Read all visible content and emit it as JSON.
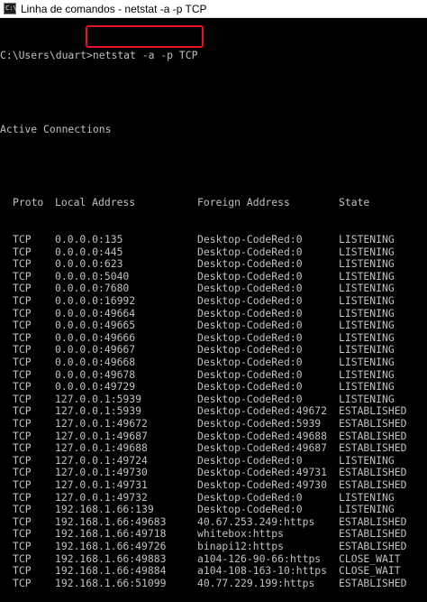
{
  "window": {
    "icon": "terminal-icon",
    "icon_glyph": "C:\\",
    "title": "Linha de comandos - netstat  -a -p TCP"
  },
  "console": {
    "prompt": "C:\\Users\\duart>",
    "command": "netstat -a -p TCP",
    "heading": "Active Connections",
    "highlight_color": "#e81123",
    "columns": {
      "proto": "Proto",
      "local": "Local Address",
      "foreign": "Foreign Address",
      "state": "State"
    },
    "rows": [
      {
        "proto": "TCP",
        "local": "0.0.0.0:135",
        "foreign": "Desktop-CodeRed:0",
        "state": "LISTENING"
      },
      {
        "proto": "TCP",
        "local": "0.0.0.0:445",
        "foreign": "Desktop-CodeRed:0",
        "state": "LISTENING"
      },
      {
        "proto": "TCP",
        "local": "0.0.0.0:623",
        "foreign": "Desktop-CodeRed:0",
        "state": "LISTENING"
      },
      {
        "proto": "TCP",
        "local": "0.0.0.0:5040",
        "foreign": "Desktop-CodeRed:0",
        "state": "LISTENING"
      },
      {
        "proto": "TCP",
        "local": "0.0.0.0:7680",
        "foreign": "Desktop-CodeRed:0",
        "state": "LISTENING"
      },
      {
        "proto": "TCP",
        "local": "0.0.0.0:16992",
        "foreign": "Desktop-CodeRed:0",
        "state": "LISTENING"
      },
      {
        "proto": "TCP",
        "local": "0.0.0.0:49664",
        "foreign": "Desktop-CodeRed:0",
        "state": "LISTENING"
      },
      {
        "proto": "TCP",
        "local": "0.0.0.0:49665",
        "foreign": "Desktop-CodeRed:0",
        "state": "LISTENING"
      },
      {
        "proto": "TCP",
        "local": "0.0.0.0:49666",
        "foreign": "Desktop-CodeRed:0",
        "state": "LISTENING"
      },
      {
        "proto": "TCP",
        "local": "0.0.0.0:49667",
        "foreign": "Desktop-CodeRed:0",
        "state": "LISTENING"
      },
      {
        "proto": "TCP",
        "local": "0.0.0.0:49668",
        "foreign": "Desktop-CodeRed:0",
        "state": "LISTENING"
      },
      {
        "proto": "TCP",
        "local": "0.0.0.0:49678",
        "foreign": "Desktop-CodeRed:0",
        "state": "LISTENING"
      },
      {
        "proto": "TCP",
        "local": "0.0.0.0:49729",
        "foreign": "Desktop-CodeRed:0",
        "state": "LISTENING"
      },
      {
        "proto": "TCP",
        "local": "127.0.0.1:5939",
        "foreign": "Desktop-CodeRed:0",
        "state": "LISTENING"
      },
      {
        "proto": "TCP",
        "local": "127.0.0.1:5939",
        "foreign": "Desktop-CodeRed:49672",
        "state": "ESTABLISHED"
      },
      {
        "proto": "TCP",
        "local": "127.0.0.1:49672",
        "foreign": "Desktop-CodeRed:5939",
        "state": "ESTABLISHED"
      },
      {
        "proto": "TCP",
        "local": "127.0.0.1:49687",
        "foreign": "Desktop-CodeRed:49688",
        "state": "ESTABLISHED"
      },
      {
        "proto": "TCP",
        "local": "127.0.0.1:49688",
        "foreign": "Desktop-CodeRed:49687",
        "state": "ESTABLISHED"
      },
      {
        "proto": "TCP",
        "local": "127.0.0.1:49724",
        "foreign": "Desktop-CodeRed:0",
        "state": "LISTENING"
      },
      {
        "proto": "TCP",
        "local": "127.0.0.1:49730",
        "foreign": "Desktop-CodeRed:49731",
        "state": "ESTABLISHED"
      },
      {
        "proto": "TCP",
        "local": "127.0.0.1:49731",
        "foreign": "Desktop-CodeRed:49730",
        "state": "ESTABLISHED"
      },
      {
        "proto": "TCP",
        "local": "127.0.0.1:49732",
        "foreign": "Desktop-CodeRed:0",
        "state": "LISTENING"
      },
      {
        "proto": "TCP",
        "local": "192.168.1.66:139",
        "foreign": "Desktop-CodeRed:0",
        "state": "LISTENING"
      },
      {
        "proto": "TCP",
        "local": "192.168.1.66:49683",
        "foreign": "40.67.253.249:https",
        "state": "ESTABLISHED"
      },
      {
        "proto": "TCP",
        "local": "192.168.1.66:49718",
        "foreign": "whitebox:https",
        "state": "ESTABLISHED"
      },
      {
        "proto": "TCP",
        "local": "192.168.1.66:49726",
        "foreign": "binapi12:https",
        "state": "ESTABLISHED"
      },
      {
        "proto": "TCP",
        "local": "192.168.1.66:49883",
        "foreign": "a104-126-90-66:https",
        "state": "CLOSE_WAIT"
      },
      {
        "proto": "TCP",
        "local": "192.168.1.66:49884",
        "foreign": "a104-108-163-10:https",
        "state": "CLOSE_WAIT"
      },
      {
        "proto": "TCP",
        "local": "192.168.1.66:51099",
        "foreign": "40.77.229.199:https",
        "state": "ESTABLISHED"
      }
    ]
  }
}
